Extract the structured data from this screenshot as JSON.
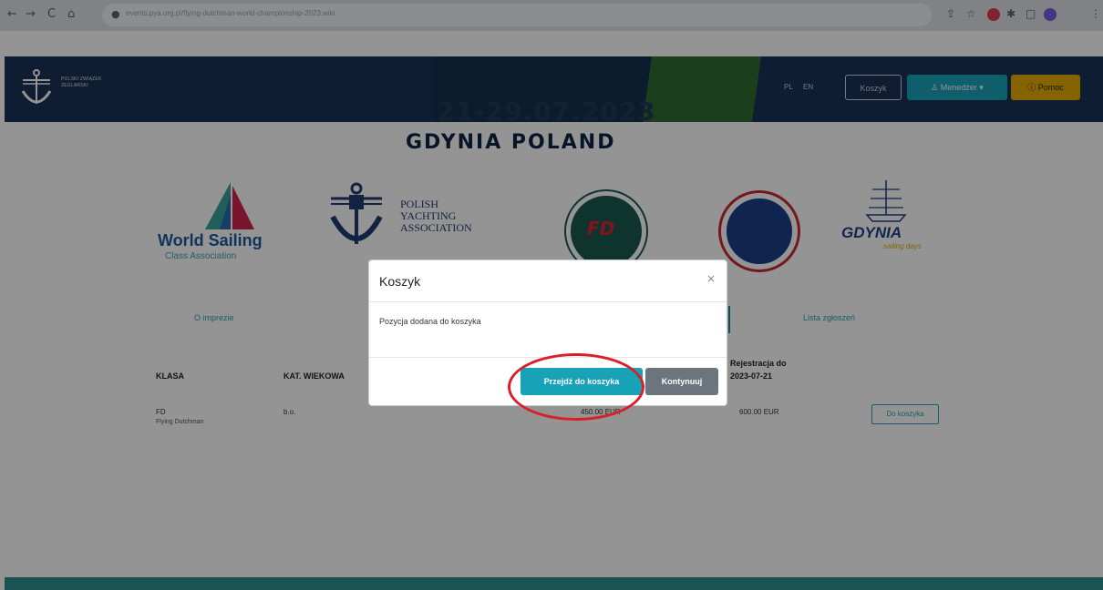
{
  "browser": {
    "back": "←",
    "forward": "→",
    "reload": "C",
    "home": "⌂",
    "url": "events.pya.org.pl/flying-dutchman-world-championship-2023.wiki"
  },
  "header": {
    "logo_text": "POLSKI ZWIĄZEK ŻEGLARSKI",
    "lang_pl": "PL",
    "lang_en": "EN",
    "cart_label": "Koszyk",
    "user_label": "Menedżer",
    "help_label": "Pomoc"
  },
  "banner": {
    "date": "21-29.07.2023",
    "place": "GDYNIA POLAND"
  },
  "sponsors": {
    "ws_title": "World Sailing",
    "ws_sub": "Class Association",
    "pya_line1": "POLISH",
    "pya_line2": "YACHTING",
    "pya_line3": "ASSOCIATION",
    "fd_text": "FD",
    "gdynia": "GDYNIA",
    "gdynia_sub": "sailing days"
  },
  "tabs": {
    "left": "O imprezie",
    "right": "Lista zgłoszeń"
  },
  "table": {
    "headers": [
      "KLASA",
      "KAT. WIEKOWA",
      "Rejestracja do",
      "2023-07-21"
    ],
    "row": {
      "class": "FD",
      "class_name": "Flying Dutchman",
      "category": "b.o.",
      "price1": "450.00 EUR",
      "price2": "600.00 EUR",
      "button": "Do koszyka"
    }
  },
  "modal": {
    "title": "Koszyk",
    "close": "×",
    "message": "Pozycja dodana do koszyka",
    "goto_label": "Przejdź do koszyka",
    "continue_label": "Kontynuuj"
  },
  "colors": {
    "accent": "#17a2b8",
    "secondary": "#6c757d",
    "header_bg": "#1b3356",
    "highlight": "#d9202a"
  }
}
